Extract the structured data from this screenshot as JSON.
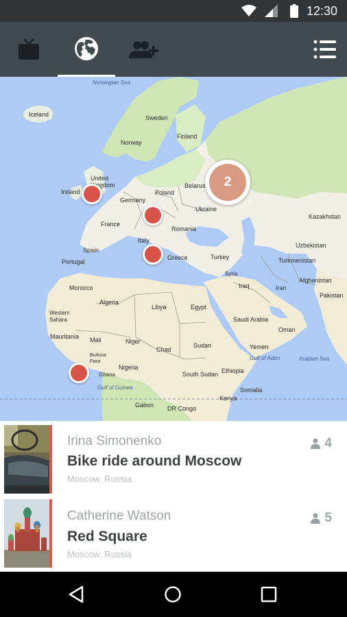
{
  "status_bar": {
    "time": "12:30"
  },
  "toolbar": {
    "tabs": [
      {
        "name": "tv-icon",
        "active": false
      },
      {
        "name": "globe-icon",
        "active": true
      },
      {
        "name": "add-user-icon",
        "active": false
      }
    ]
  },
  "map": {
    "labels": {
      "norwegian_sea": "Norwegian Sea",
      "iceland": "Iceland",
      "sweden": "Sweden",
      "norway": "Norway",
      "finland": "Finland",
      "united_kingdom": "United Kingdom",
      "ireland": "Ireland",
      "belarus": "Belarus",
      "germany": "Germany",
      "poland": "Poland",
      "ukraine": "Ukraine",
      "france": "France",
      "kazakhstan": "Kazakhstan",
      "romania": "Romania",
      "italy": "Italy",
      "uzbekistan": "Uzbekistan",
      "spain": "Spain",
      "turkmenistan": "Turkmenistan",
      "portugal": "Portugal",
      "greece": "Greece",
      "turkey": "Turkey",
      "syria": "Syria",
      "afghanistan": "Afghanistan",
      "iraq": "Iraq",
      "iran": "Iran",
      "pakistan": "Pakistan",
      "morocco": "Morocco",
      "algeria": "Algeria",
      "libya": "Libya",
      "egypt": "Egypt",
      "western_sahara": "Western Sahara",
      "saudi_arabia": "Saudi Arabia",
      "mauritania": "Mauritania",
      "mali": "Mali",
      "niger": "Niger",
      "sudan": "Sudan",
      "yemen": "Yemen",
      "oman": "Oman",
      "chad": "Chad",
      "burkina_faso": "Burkina Faso",
      "gulf_of_aden": "Gulf of Aden",
      "arabian_sea": "Arabian Sea",
      "nigeria": "Nigeria",
      "ghana": "Ghana",
      "south_sudan": "South Sudan",
      "ethiopia": "Ethiopia",
      "gulf_of_guinea": "Gulf of Guinea",
      "somalia": "Somalia",
      "kenya": "Kenya",
      "gabon": "Gabon",
      "dr_congo": "DR Congo"
    },
    "cluster_count": "2",
    "colors": {
      "water": "#aecbf6",
      "land": "#f2efe6",
      "forest": "#cfe6b4",
      "pin": "#d85448",
      "cluster": "#d99a82"
    }
  },
  "list": [
    {
      "author": "Irina Simonenko",
      "title": "Bike ride around Moscow",
      "location": "Moscow, Russia",
      "count": "4"
    },
    {
      "author": "Catherine Watson",
      "title": "Red Square",
      "location": "Moscow, Russia",
      "count": "5"
    }
  ],
  "nav": {
    "back": "back-icon",
    "home": "home-icon",
    "recents": "recents-icon"
  }
}
